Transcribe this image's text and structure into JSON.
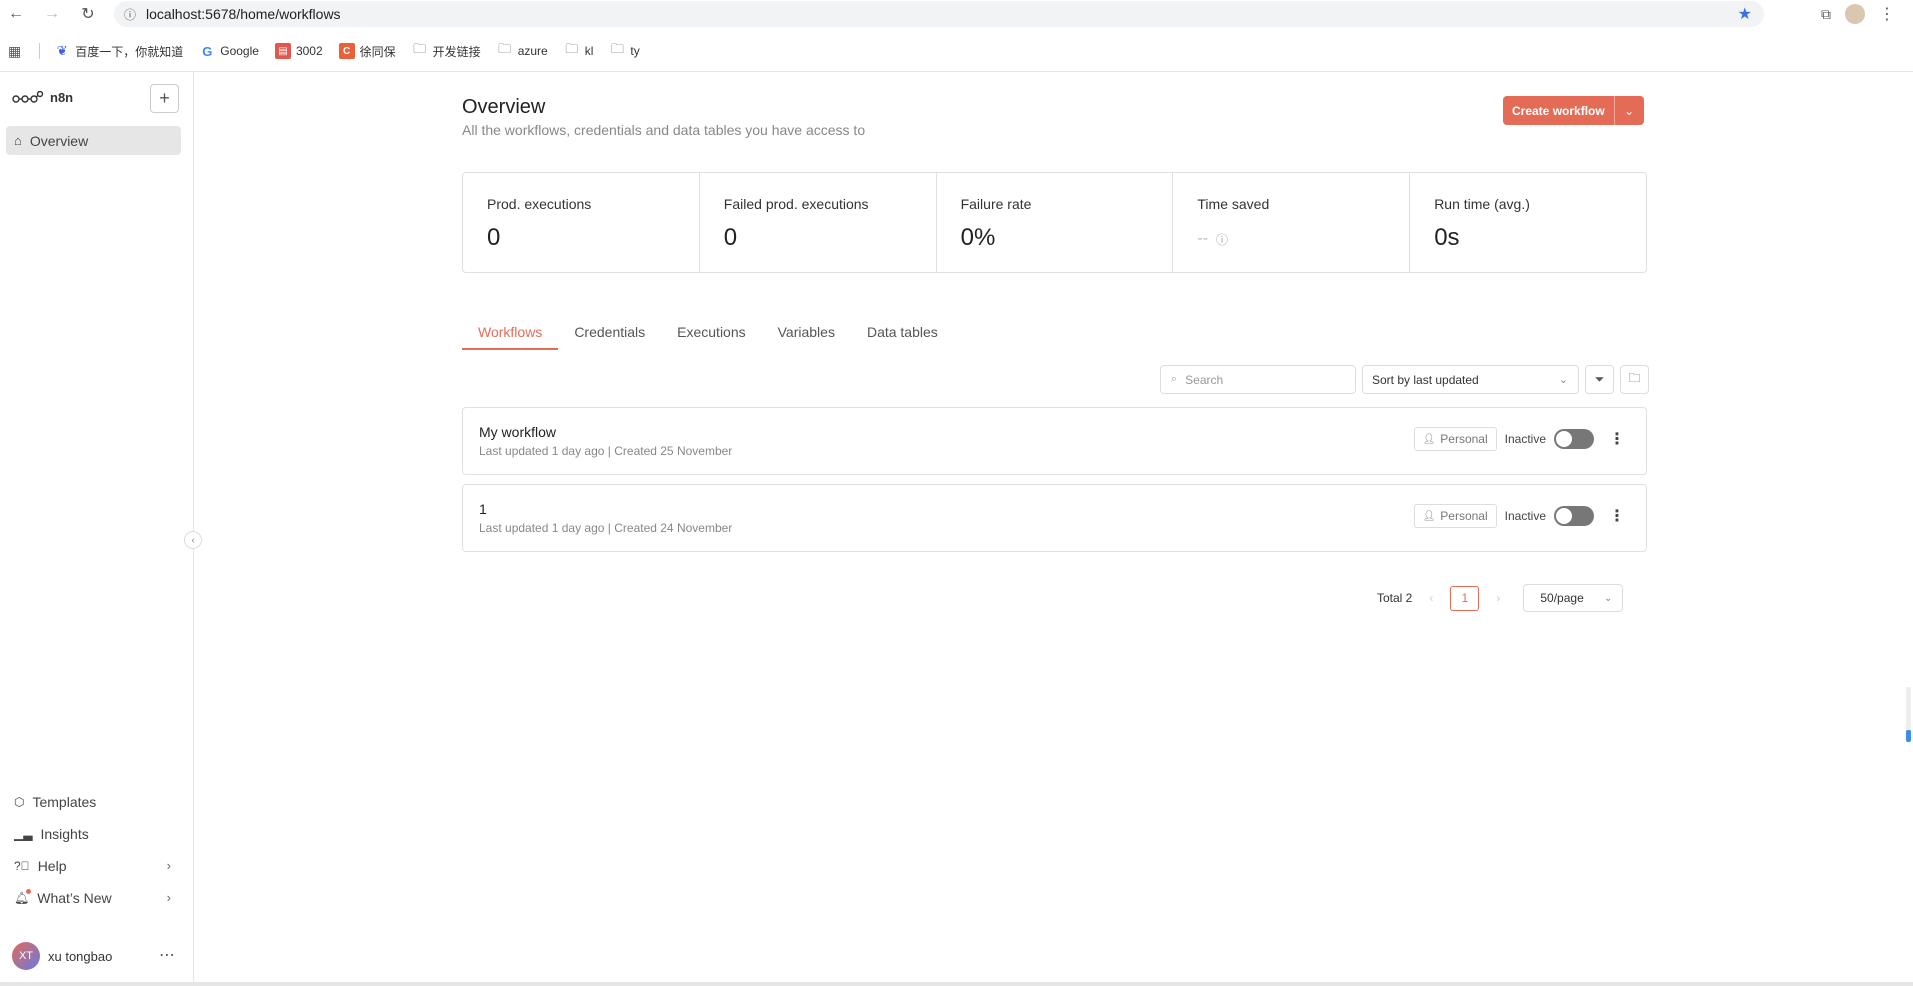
{
  "browser": {
    "url": "localhost:5678/home/workflows",
    "bookmarks": [
      {
        "label": "百度一下，你就知道",
        "icon": "baidu-icon",
        "color": "#3b5ee6"
      },
      {
        "label": "Google",
        "icon": "google-icon",
        "color": "#4285f4"
      },
      {
        "label": "3002",
        "icon": "app-icon",
        "color": "#e0584f"
      },
      {
        "label": "徐同保",
        "icon": "c-icon",
        "color": "#e8613c"
      },
      {
        "label": "开发链接",
        "icon": "folder-icon",
        "color": "#555"
      },
      {
        "label": "azure",
        "icon": "folder-icon",
        "color": "#555"
      },
      {
        "label": "kl",
        "icon": "folder-icon",
        "color": "#555"
      },
      {
        "label": "ty",
        "icon": "folder-icon",
        "color": "#555"
      }
    ]
  },
  "sidebar": {
    "brand": "n8n",
    "overview": "Overview",
    "templates": "Templates",
    "insights": "Insights",
    "help": "Help",
    "whats_new": "What’s New",
    "user_initials": "XT",
    "user_name": "xu tongbao"
  },
  "header": {
    "title": "Overview",
    "subtitle": "All the workflows, credentials and data tables you have access to",
    "create_label": "Create workflow"
  },
  "stats": [
    {
      "label": "Prod. executions",
      "value": "0"
    },
    {
      "label": "Failed prod. executions",
      "value": "0"
    },
    {
      "label": "Failure rate",
      "value": "0%"
    },
    {
      "label": "Time saved",
      "value": "--"
    },
    {
      "label": "Run time (avg.)",
      "value": "0s"
    }
  ],
  "tabs": [
    "Workflows",
    "Credentials",
    "Executions",
    "Variables",
    "Data tables"
  ],
  "toolbar": {
    "search_placeholder": "Search",
    "sort_label": "Sort by last updated"
  },
  "workflows": [
    {
      "title": "My workflow",
      "updated": "Last updated 1 day ago",
      "created": "Created 25 November",
      "owner": "Personal",
      "status": "Inactive"
    },
    {
      "title": "1",
      "updated": "Last updated 1 day ago",
      "created": "Created 24 November",
      "owner": "Personal",
      "status": "Inactive"
    }
  ],
  "pagination": {
    "total": "Total 2",
    "page": "1",
    "per_page": "50/page"
  },
  "colors": {
    "accent": "#e46c57"
  }
}
